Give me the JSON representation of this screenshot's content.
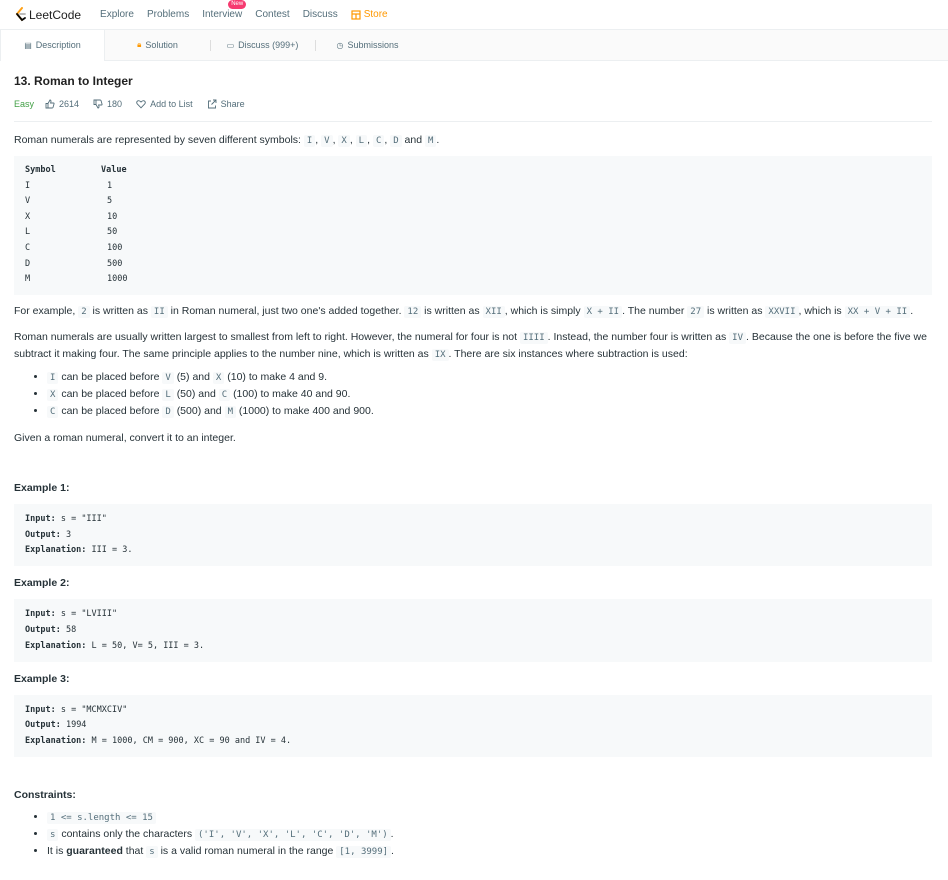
{
  "nav": {
    "logo_text": "LeetCode",
    "items": [
      "Explore",
      "Problems",
      "Interview",
      "Contest",
      "Discuss"
    ],
    "new_badge": "New",
    "store": "Store"
  },
  "tabs": [
    "Description",
    "Solution",
    "Discuss (999+)",
    "Submissions"
  ],
  "problem": {
    "title": "13. Roman to Integer",
    "difficulty": "Easy",
    "likes": "2614",
    "dislikes": "180",
    "add_to_list": "Add to List",
    "share": "Share"
  },
  "intro": {
    "text": "Roman numerals are represented by seven different symbols:",
    "symbols": [
      "I",
      "V",
      "X",
      "L",
      "C",
      "D",
      "M"
    ],
    "and": "and"
  },
  "symbol_table": {
    "headers": [
      "Symbol",
      "Value"
    ],
    "rows": [
      [
        "I",
        "1"
      ],
      [
        "V",
        "5"
      ],
      [
        "X",
        "10"
      ],
      [
        "L",
        "50"
      ],
      [
        "C",
        "100"
      ],
      [
        "D",
        "500"
      ],
      [
        "M",
        "1000"
      ]
    ]
  },
  "example_para": {
    "t1": "For example,",
    "c1": "2",
    "t2": "is written as",
    "c2": "II",
    "t3": "in Roman numeral, just two one's added together.",
    "c3": "12",
    "t4": "is written as",
    "c4": "XII",
    "t5": ", which is simply",
    "c5": "X + II",
    "t6": ". The number",
    "c6": "27",
    "t7": "is written as",
    "c7": "XXVII",
    "t8": ", which is",
    "c8": "XX + V + II",
    "t9": "."
  },
  "order_para": {
    "t1": "Roman numerals are usually written largest to smallest from left to right. However, the numeral for four is not",
    "c1": "IIII",
    "t2": ". Instead, the number four is written as",
    "c2": "IV",
    "t3": ". Because the one is before the five we subtract it making four. The same principle applies to the number nine, which is written as",
    "c3": "IX",
    "t4": ". There are six instances where subtraction is used:"
  },
  "rules": [
    {
      "a": "I",
      "t1": "can be placed before",
      "b": "V",
      "t2": "(5) and",
      "c": "X",
      "t3": "(10) to make 4 and 9."
    },
    {
      "a": "X",
      "t1": "can be placed before",
      "b": "L",
      "t2": "(50) and",
      "c": "C",
      "t3": "(100) to make 40 and 90."
    },
    {
      "a": "C",
      "t1": "can be placed before",
      "b": "D",
      "t2": "(500) and",
      "c": "M",
      "t3": "(1000) to make 400 and 900."
    }
  ],
  "task": "Given a roman numeral, convert it to an integer.",
  "examples": [
    {
      "heading": "Example 1:",
      "input_label": "Input:",
      "input": "s = \"III\"",
      "output_label": "Output:",
      "output": "3",
      "expl_label": "Explanation:",
      "expl": "III = 3."
    },
    {
      "heading": "Example 2:",
      "input_label": "Input:",
      "input": "s = \"LVIII\"",
      "output_label": "Output:",
      "output": "58",
      "expl_label": "Explanation:",
      "expl": "L = 50, V= 5, III = 3."
    },
    {
      "heading": "Example 3:",
      "input_label": "Input:",
      "input": "s = \"MCMXCIV\"",
      "output_label": "Output:",
      "output": "1994",
      "expl_label": "Explanation:",
      "expl": "M = 1000, CM = 900, XC = 90 and IV = 4."
    }
  ],
  "constraints": {
    "heading": "Constraints:",
    "c1": "1 <= s.length <= 15",
    "c2_code": "s",
    "c2_text": "contains only the characters",
    "c2_chars": "('I', 'V', 'X', 'L', 'C', 'D', 'M')",
    "c2_end": ".",
    "c3_t1": "It is",
    "c3_bold": "guaranteed",
    "c3_t2": "that",
    "c3_code": "s",
    "c3_t3": "is a valid roman numeral in the range",
    "c3_range": "[1, 3999]",
    "c3_end": "."
  },
  "colors": {
    "easy": "#43a047",
    "store": "#ff9800",
    "badge": "#f63b70"
  }
}
